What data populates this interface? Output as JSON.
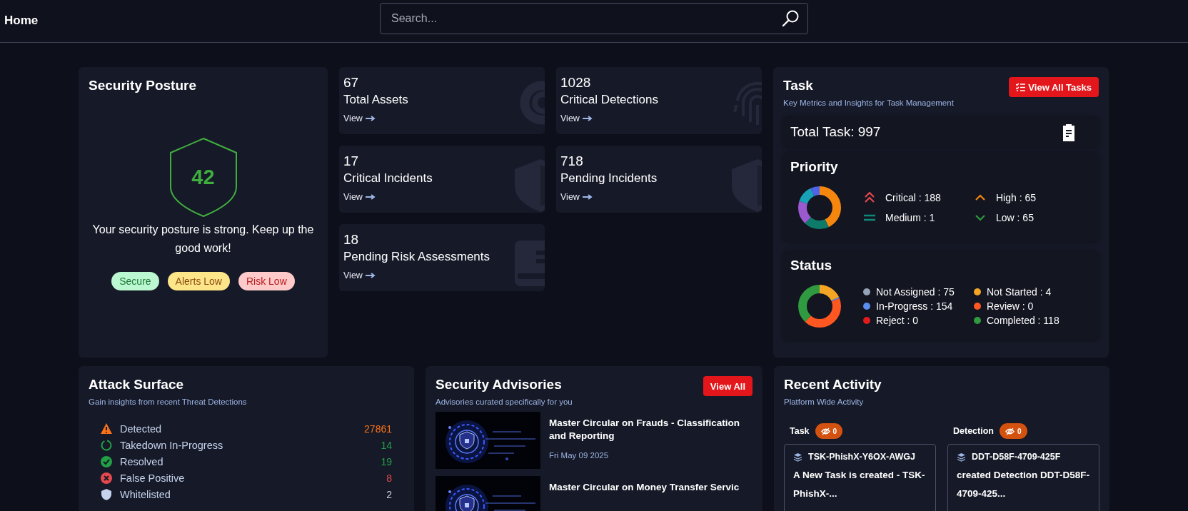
{
  "header": {
    "title": "Home",
    "search": {
      "placeholder": "Search..."
    }
  },
  "security_posture": {
    "title": "Security Posture",
    "score": "42",
    "message": "Your security posture is strong. Keep up the good work!",
    "badges": [
      {
        "label": "Secure",
        "color": "#bbf7d0"
      },
      {
        "label": "Alerts Low",
        "color": "#fde68a"
      },
      {
        "label": "Risk Low",
        "color": "#fecaca"
      }
    ]
  },
  "metrics": [
    {
      "kind": "assets",
      "value": "67",
      "label": "Total Assets",
      "link": "View"
    },
    {
      "kind": "detections",
      "value": "1028",
      "label": "Critical Detections",
      "link": "View"
    },
    {
      "kind": "incidents",
      "value": "17",
      "label": "Critical Incidents",
      "link": "View"
    },
    {
      "kind": "incidents",
      "value": "718",
      "label": "Pending Incidents",
      "link": "View"
    },
    {
      "kind": "risk",
      "value": "18",
      "label": "Pending Risk Assessments",
      "link": "View"
    }
  ],
  "task": {
    "title": "Task",
    "subtitle": "Key Metrics and Insights for Task Management",
    "button": "View All Tasks",
    "total": "Total Task: 997",
    "priority": {
      "title": "Priority",
      "items": [
        {
          "kind": "critical",
          "label": "Critical : 188"
        },
        {
          "kind": "high",
          "label": "High : 65"
        },
        {
          "kind": "medium",
          "label": "Medium : 1"
        },
        {
          "kind": "low",
          "label": "Low : 65"
        }
      ]
    },
    "status": {
      "title": "Status",
      "items": [
        {
          "label": "Not Assigned : 75",
          "color": "#94a3b8"
        },
        {
          "label": "Not Started : 4",
          "color": "#f5a524"
        },
        {
          "label": "In-Progress : 154",
          "color": "#5b8def"
        },
        {
          "label": "Review : 0",
          "color": "#ff5722"
        },
        {
          "label": "Reject : 0",
          "color": "#e31b1b"
        },
        {
          "label": "Completed : 118",
          "color": "#2f9a3f"
        }
      ]
    }
  },
  "attack_surface": {
    "title": "Attack Surface",
    "subtitle": "Gain insights from recent Threat Detections",
    "rows": [
      {
        "kind": "detected",
        "label": "Detected",
        "count": "27861",
        "color": "#f97316"
      },
      {
        "kind": "takedown",
        "label": "Takedown In-Progress",
        "count": "14",
        "color": "#22a046"
      },
      {
        "kind": "resolved",
        "label": "Resolved",
        "count": "19",
        "color": "#22a046"
      },
      {
        "kind": "false_positive",
        "label": "False Positive",
        "count": "8",
        "color": "#e5484d"
      },
      {
        "kind": "whitelisted",
        "label": "Whitelisted",
        "count": "2",
        "color": "#c5d3ee"
      }
    ]
  },
  "advisories": {
    "title": "Security Advisories",
    "subtitle": "Advisories curated specifically for you",
    "button": "View All",
    "items": [
      {
        "kind": "picture",
        "title": "Master Circular on Frauds - Classification and Reporting",
        "date": "Fri May 09 2025"
      },
      {
        "kind": "picture",
        "title": "Master Circular on Money Transfer Servic"
      }
    ]
  },
  "recent_activity": {
    "title": "Recent Activity",
    "subtitle": "Platform Wide Activity",
    "columns": [
      {
        "label": "Task",
        "hidden_count": "0",
        "entries": [
          {
            "id": "TSK-PhishX-Y6OX-AWGJ",
            "text": "A New Task is created - TSK-PhishX-..."
          }
        ]
      },
      {
        "label": "Detection",
        "hidden_count": "0",
        "entries": [
          {
            "id": "DDT-D58F-4709-425F",
            "text": "created Detection DDT-D58F-4709-425..."
          }
        ]
      }
    ]
  }
}
